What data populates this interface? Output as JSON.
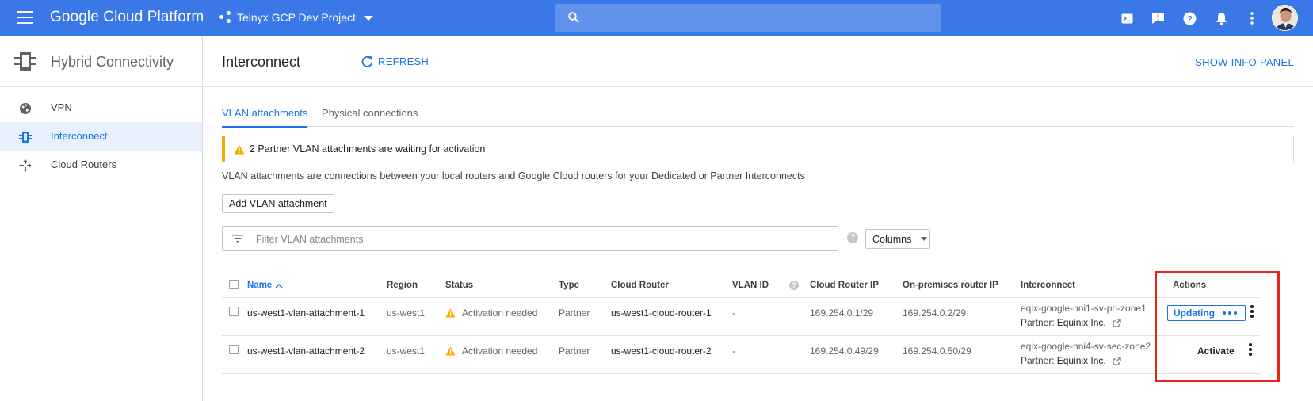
{
  "topbar": {
    "brand": "Google Cloud Platform",
    "project": "Telnyx GCP Dev Project",
    "icons": [
      "menu-icon",
      "search-icon",
      "cloud-shell-icon",
      "feedback-icon",
      "help-icon",
      "notifications-icon",
      "more-icon",
      "avatar"
    ],
    "color": "#3b78e7"
  },
  "sidebar": {
    "title": "Hybrid Connectivity",
    "items": [
      {
        "label": "VPN",
        "icon": "globe-icon",
        "active": false
      },
      {
        "label": "Interconnect",
        "icon": "interconnect-icon",
        "active": true
      },
      {
        "label": "Cloud Routers",
        "icon": "router-icon",
        "active": false
      }
    ]
  },
  "header": {
    "title": "Interconnect",
    "refresh_label": "REFRESH",
    "info_panel_label": "SHOW INFO PANEL"
  },
  "tabs": [
    {
      "label": "VLAN attachments",
      "active": true
    },
    {
      "label": "Physical connections",
      "active": false
    }
  ],
  "warning": {
    "text": "2 Partner VLAN attachments are waiting for activation",
    "color": "#f9ab00"
  },
  "description": "VLAN attachments are connections between your local routers and Google Cloud routers for your Dedicated or Partner Interconnects",
  "add_button_label": "Add VLAN attachment",
  "filter": {
    "placeholder": "Filter VLAN attachments",
    "columns_label": "Columns"
  },
  "table": {
    "headers": {
      "name": "Name",
      "region": "Region",
      "status": "Status",
      "type": "Type",
      "cloud_router": "Cloud Router",
      "vlan_id": "VLAN ID",
      "cloud_router_ip": "Cloud Router IP",
      "onprem_ip": "On-premises router IP",
      "interconnect": "Interconnect",
      "actions": "Actions"
    },
    "rows": [
      {
        "name": "us-west1-vlan-attachment-1",
        "region": "us-west1",
        "status": "Activation needed",
        "type": "Partner",
        "cloud_router": "us-west1-cloud-router-1",
        "vlan_id": "-",
        "cloud_router_ip": "169.254.0.1/29",
        "onprem_ip": "169.254.0.2/29",
        "interconnect": "eqix-google-nni1-sv-pri-zone1",
        "partner_label": "Partner:",
        "partner": "Equinix Inc.",
        "action": "Updating"
      },
      {
        "name": "us-west1-vlan-attachment-2",
        "region": "us-west1",
        "status": "Activation needed",
        "type": "Partner",
        "cloud_router": "us-west1-cloud-router-2",
        "vlan_id": "-",
        "cloud_router_ip": "169.254.0.49/29",
        "onprem_ip": "169.254.0.50/29",
        "interconnect": "eqix-google-nni4-sv-sec-zone2",
        "partner_label": "Partner:",
        "partner": "Equinix Inc.",
        "action": "Activate"
      }
    ]
  },
  "highlight_color": "#e8251a"
}
